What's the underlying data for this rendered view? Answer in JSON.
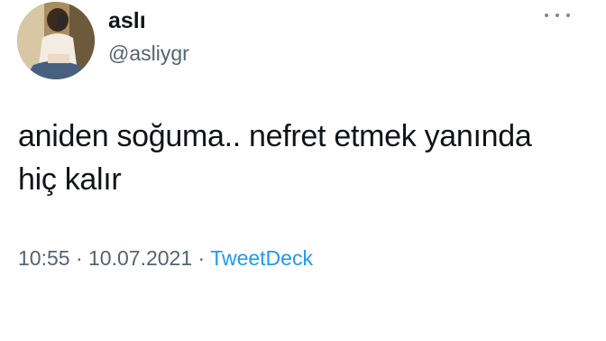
{
  "tweet": {
    "author": {
      "display_name": "aslı",
      "handle": "@asliygr"
    },
    "more_icon": "more-horizontal-icon",
    "text": "aniden soğuma.. nefret etmek yanında\nhiç kalır",
    "time": "10:55",
    "date": "10.07.2021",
    "separator": "·",
    "source": "TweetDeck",
    "colors": {
      "text": "#0f1419",
      "secondary": "#536471",
      "link": "#1d9bf0"
    }
  }
}
